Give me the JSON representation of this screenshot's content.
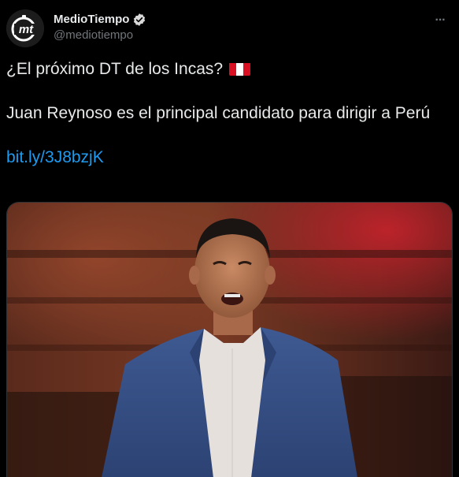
{
  "author": {
    "display_name": "MedioTiempo",
    "handle": "@mediotiempo",
    "avatar_text": "mt",
    "avatar_icon": "mediotiempo-logo-icon",
    "verified_icon": "verified-badge-icon"
  },
  "menu": {
    "icon": "more-options-icon",
    "glyph": "···"
  },
  "tweet": {
    "line1": "¿El próximo DT de los Incas?",
    "flag_icon": "peru-flag-icon",
    "line2": "Juan Reynoso es el principal candidato para dirigir a Perú",
    "link": "bit.ly/3J8bzjK"
  },
  "media": {
    "icon": "coach-photo-icon"
  },
  "colors": {
    "background": "#000000",
    "text": "#e7e9ea",
    "secondary": "#71767b",
    "link": "#1d9bf0",
    "verified": "#d9d9d9",
    "peru_red": "#d91023"
  }
}
